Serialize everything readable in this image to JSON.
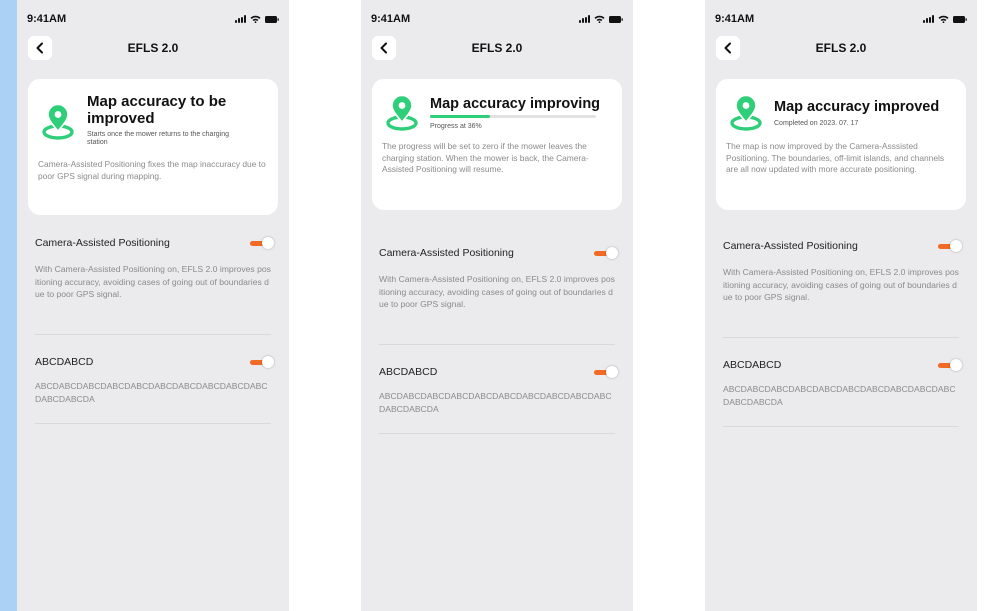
{
  "screens": [
    {
      "time": "9:41AM",
      "title": "EFLS 2.0",
      "card": {
        "title": "Map accuracy to be improved",
        "subtitle": "Starts once the mower returns to the charging station",
        "body": "Camera-Assisted Positioning fixes the map inaccuracy due to poor GPS signal during mapping."
      },
      "settings": [
        {
          "title": "Camera-Assisted Positioning",
          "description": "With Camera-Assisted Positioning on, EFLS 2.0 improves positioning accuracy, avoiding cases of going out of boundaries due to poor GPS signal.",
          "enabled": true
        },
        {
          "title": "ABCDABCD",
          "description": "ABCDABCDABCDABCDABCDABCDABCDABCDABCDABCDABCDABCDA",
          "enabled": true
        }
      ]
    },
    {
      "time": "9:41AM",
      "title": "EFLS 2.0",
      "card": {
        "title": "Map accuracy improving",
        "subtitle": "Progress at 36%",
        "progress": 0.36,
        "body": "The progress will be set to zero if the mower leaves the charging station. When the mower is back, the Camera-Assisted Positioning will resume."
      },
      "settings": [
        {
          "title": "Camera-Assisted Positioning",
          "description": "With Camera-Assisted Positioning on, EFLS 2.0 improves positioning accuracy, avoiding cases of going out of boundaries due to poor GPS signal.",
          "enabled": true
        },
        {
          "title": "ABCDABCD",
          "description": "ABCDABCDABCDABCDABCDABCDABCDABCDABCDABCDABCDABCDA",
          "enabled": true
        }
      ]
    },
    {
      "time": "9:41AM",
      "title": "EFLS 2.0",
      "card": {
        "title": "Map accuracy improved",
        "subtitle": "Completed on 2023. 07. 17",
        "body": "The map is now improved by the Camera-Asssisted Positioning. The boundaries, off-limit islands, and channels are all now updated with more accurate positioning."
      },
      "settings": [
        {
          "title": "Camera-Assisted Positioning",
          "description": "With Camera-Assisted Positioning on, EFLS 2.0 improves positioning accuracy, avoiding cases of going out of boundaries due to poor GPS signal.",
          "enabled": true
        },
        {
          "title": "ABCDABCD",
          "description": "ABCDABCDABCDABCDABCDABCDABCDABCDABCDABCDABCDABCDA",
          "enabled": true
        }
      ]
    }
  ],
  "icons": {
    "back": "chevron-left-icon",
    "card": "map-pin-icon",
    "signal": "cellular-signal-icon",
    "wifi": "wifi-icon",
    "battery": "battery-icon"
  },
  "colors": {
    "accent": "#f26a23",
    "success": "#2fcf7a",
    "background": "#ebebee",
    "card": "#ffffff",
    "text_secondary": "#8b8b8b"
  }
}
